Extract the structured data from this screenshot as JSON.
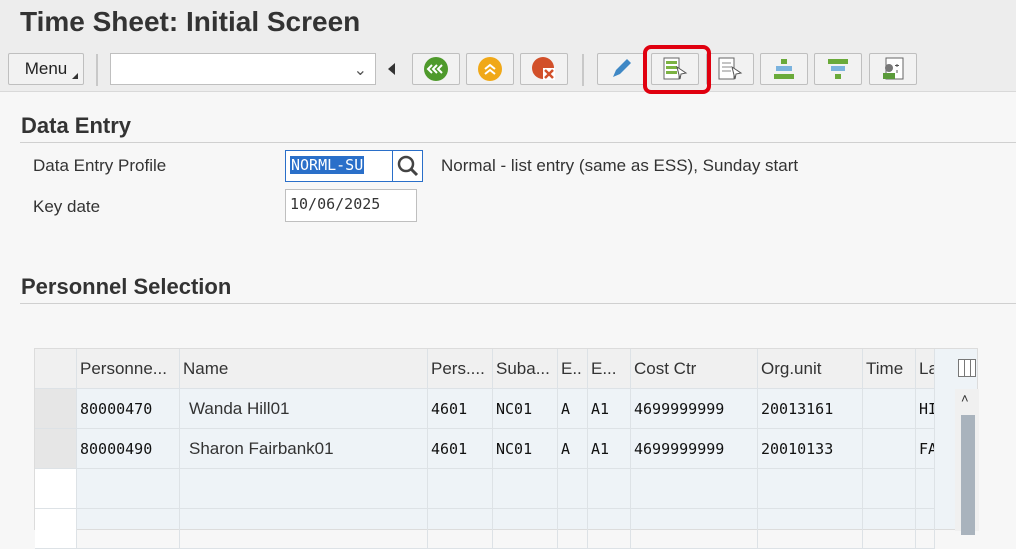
{
  "header": {
    "title": "Time Sheet: Initial Screen"
  },
  "toolbar": {
    "menu_label": "Menu",
    "command_field": "",
    "buttons": [
      "back-icon",
      "exit-icon",
      "cancel-icon",
      "edit-icon",
      "enter-times-icon",
      "display-icon",
      "overview-icon",
      "filter-icon",
      "personnel-icon"
    ],
    "highlight_color": "#e0000f"
  },
  "data_entry": {
    "heading": "Data Entry",
    "profile_label": "Data Entry Profile",
    "profile_value": "NORML-SU",
    "profile_desc": "Normal - list entry (same as ESS), Sunday start",
    "key_date_label": "Key date",
    "key_date_value": "10/06/2025"
  },
  "personnel": {
    "heading": "Personnel Selection",
    "columns": [
      "Personne...",
      "Name",
      "Pers....",
      "Suba...",
      "E..",
      "E...",
      "Cost Ctr",
      "Org.unit",
      "Time",
      "Last"
    ],
    "rows": [
      [
        "80000470",
        "Wanda Hill01",
        "4601",
        "NC01",
        "A",
        "A1",
        "4699999999",
        "20013161",
        "",
        "HILI"
      ],
      [
        "80000490",
        "Sharon Fairbank01",
        "4601",
        "NC01",
        "A",
        "A1",
        "4699999999",
        "20010133",
        "",
        "FAII"
      ]
    ]
  }
}
